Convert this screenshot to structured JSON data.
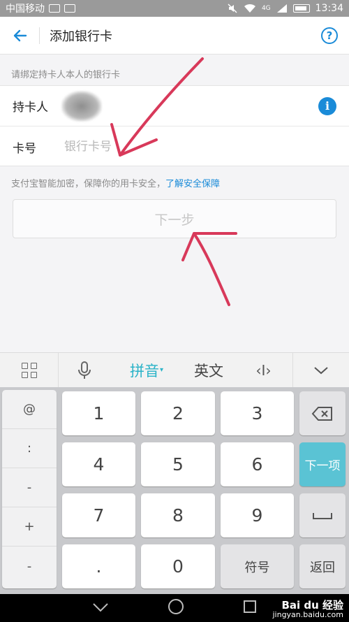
{
  "status_bar": {
    "carrier": "中国移动",
    "network": "4G",
    "time": "13:34"
  },
  "header": {
    "title": "添加银行卡",
    "back_icon": "arrow-left-icon",
    "help_icon": "question-circle-icon",
    "help_glyph": "?"
  },
  "form": {
    "hint": "请绑定持卡人本人的银行卡",
    "holder_label": "持卡人",
    "info_glyph": "i",
    "card_label": "卡号",
    "card_placeholder": "银行卡号"
  },
  "security": {
    "text": "支付宝智能加密，保障你的用卡安全，",
    "link": "了解安全保障"
  },
  "next_button": "下一步",
  "keyboard": {
    "toolbar": {
      "pinyin": "拼音",
      "pinyin_caret": "▾",
      "english": "英文",
      "cursor": "‹I›"
    },
    "symbols": [
      "@",
      ":",
      "-",
      "+",
      "-"
    ],
    "digits": [
      "1",
      "2",
      "3",
      "4",
      "5",
      "6",
      "7",
      "8",
      "9"
    ],
    "dot": ".",
    "zero": "0",
    "symbols_key": "符号",
    "next_item": "下一项",
    "back_key": "返回"
  },
  "watermark": {
    "brand": "Bai du 经验",
    "url": "jingyan.baidu.com"
  },
  "colors": {
    "accent_blue": "#1a8bd8",
    "keyboard_teal": "#5ac3d4",
    "annotation_red": "#d8395a"
  }
}
